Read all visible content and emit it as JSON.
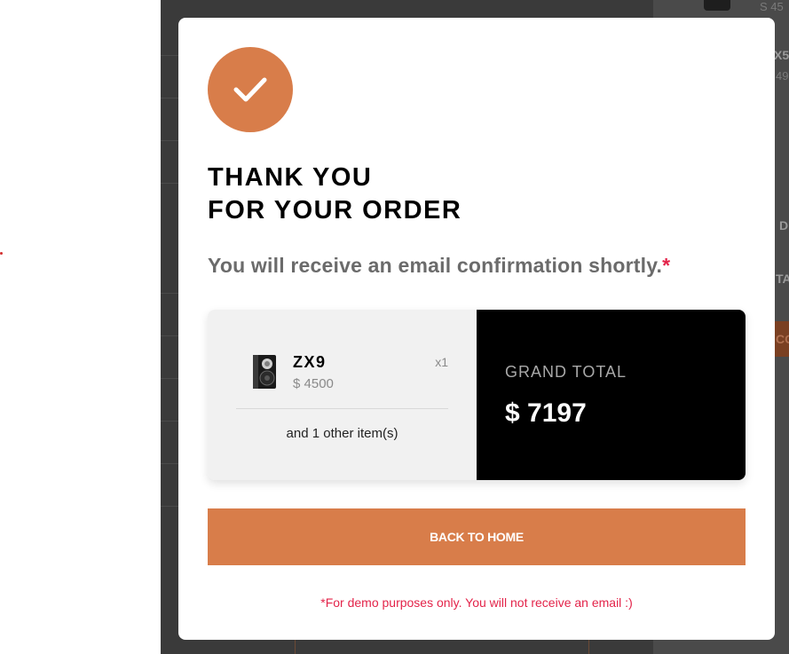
{
  "background": {
    "peek_texts": [
      "S 45",
      "X5",
      "49",
      "D",
      "TA",
      "CO"
    ]
  },
  "modal": {
    "title_line1": "THANK YOU",
    "title_line2": "FOR YOUR ORDER",
    "subtitle": "You will receive an email confirmation shortly.",
    "subtitle_asterisk": "*",
    "item": {
      "name": "ZX9",
      "price": "$ 4500",
      "quantity": "x1"
    },
    "other_items": "and 1 other item(s)",
    "grand_total_label": "GRAND TOTAL",
    "grand_total_value": "$ 7197",
    "back_button_label": "BACK TO HOME",
    "demo_note": "*For demo purposes only. You will not receive an email :)"
  },
  "colors": {
    "accent": "#d87d4a",
    "error_red": "#e3244a",
    "dark": "#000000"
  },
  "icons": {
    "success": "checkmark-icon",
    "product": "speaker-image"
  }
}
